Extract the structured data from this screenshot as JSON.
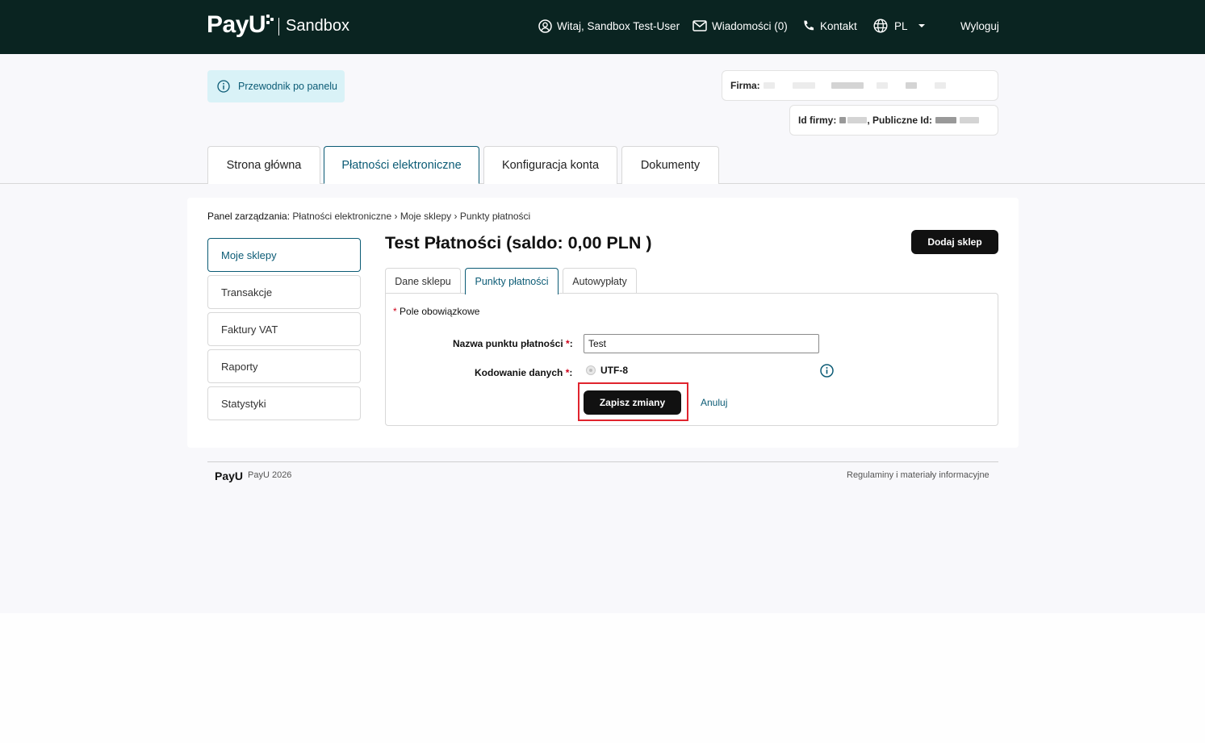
{
  "header": {
    "logo_text": "PayU",
    "environment": "Sandbox",
    "user_greeting": "Witaj, Sandbox Test-User",
    "messages": "Wiadomości (0)",
    "contact": "Kontakt",
    "language": "PL",
    "logout": "Wyloguj"
  },
  "guide": {
    "label": "Przewodnik po panelu"
  },
  "company": {
    "firm_label": "Firma:",
    "id_label": "Id firmy:",
    "public_id_label": ", Publiczne Id:"
  },
  "main_tabs": [
    {
      "label": "Strona główna"
    },
    {
      "label": "Płatności elektroniczne"
    },
    {
      "label": "Konfiguracja konta"
    },
    {
      "label": "Dokumenty"
    }
  ],
  "breadcrumb": {
    "prefix": "Panel zarządzania:",
    "path": "Płatności elektroniczne › Moje sklepy › Punkty płatności"
  },
  "sidebar": {
    "items": [
      {
        "label": "Moje sklepy"
      },
      {
        "label": "Transakcje"
      },
      {
        "label": "Faktury VAT"
      },
      {
        "label": "Raporty"
      },
      {
        "label": "Statystyki"
      }
    ]
  },
  "page": {
    "title": "Test Płatności (saldo: 0,00 PLN )",
    "add_shop_button": "Dodaj sklep"
  },
  "sub_tabs": [
    {
      "label": "Dane sklepu"
    },
    {
      "label": "Punkty płatności"
    },
    {
      "label": "Autowypłaty"
    }
  ],
  "form": {
    "required_note": "Pole obowiązkowe",
    "required_star": "*",
    "name_label": "Nazwa punktu płatności",
    "name_value": "Test",
    "encoding_label": "Kodowanie danych",
    "encoding_option": "UTF-8",
    "label_suffix": ":",
    "save_button": "Zapisz zmiany",
    "cancel_link": "Anuluj"
  },
  "footer": {
    "logo_text": "PayU",
    "copyright": "PayU 2026",
    "terms_link": "Regulaminy i materiały informacyjne"
  },
  "colors": {
    "header_bg": "#0a2421",
    "accent": "#0b5b75",
    "guide_bg": "#d9f2f7",
    "highlight": "#e0242e",
    "required": "#d0021b"
  }
}
